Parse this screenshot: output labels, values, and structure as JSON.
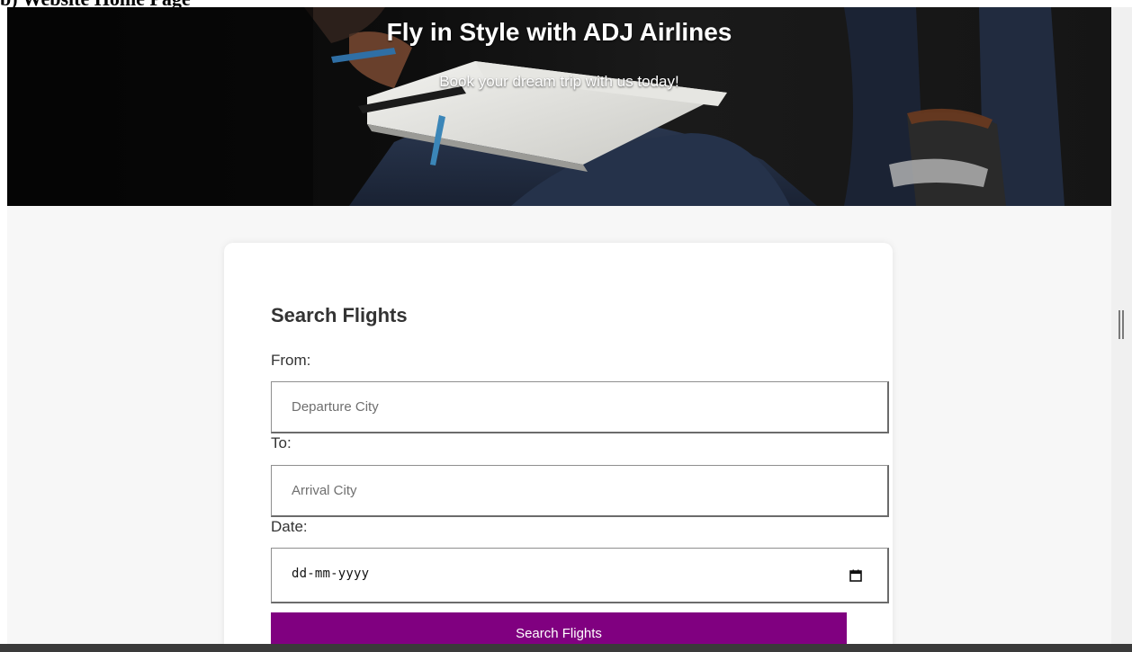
{
  "document": {
    "section_heading": "b) Website Home Page"
  },
  "hero": {
    "title": "Fly in Style with ADJ Airlines",
    "subtitle": "Book your dream trip with us today!"
  },
  "search_form": {
    "title": "Search Flights",
    "from": {
      "label": "From:",
      "placeholder": "Departure City",
      "value": ""
    },
    "to": {
      "label": "To:",
      "placeholder": "Arrival City",
      "value": ""
    },
    "date": {
      "label": "Date:",
      "placeholder": "dd-mm-yyyy"
    },
    "submit_label": "Search Flights"
  },
  "colors": {
    "button_bg": "#800080",
    "button_text": "#ffffff",
    "page_bg": "#f7f7f7",
    "card_bg": "#ffffff",
    "heading_text": "#333333"
  }
}
